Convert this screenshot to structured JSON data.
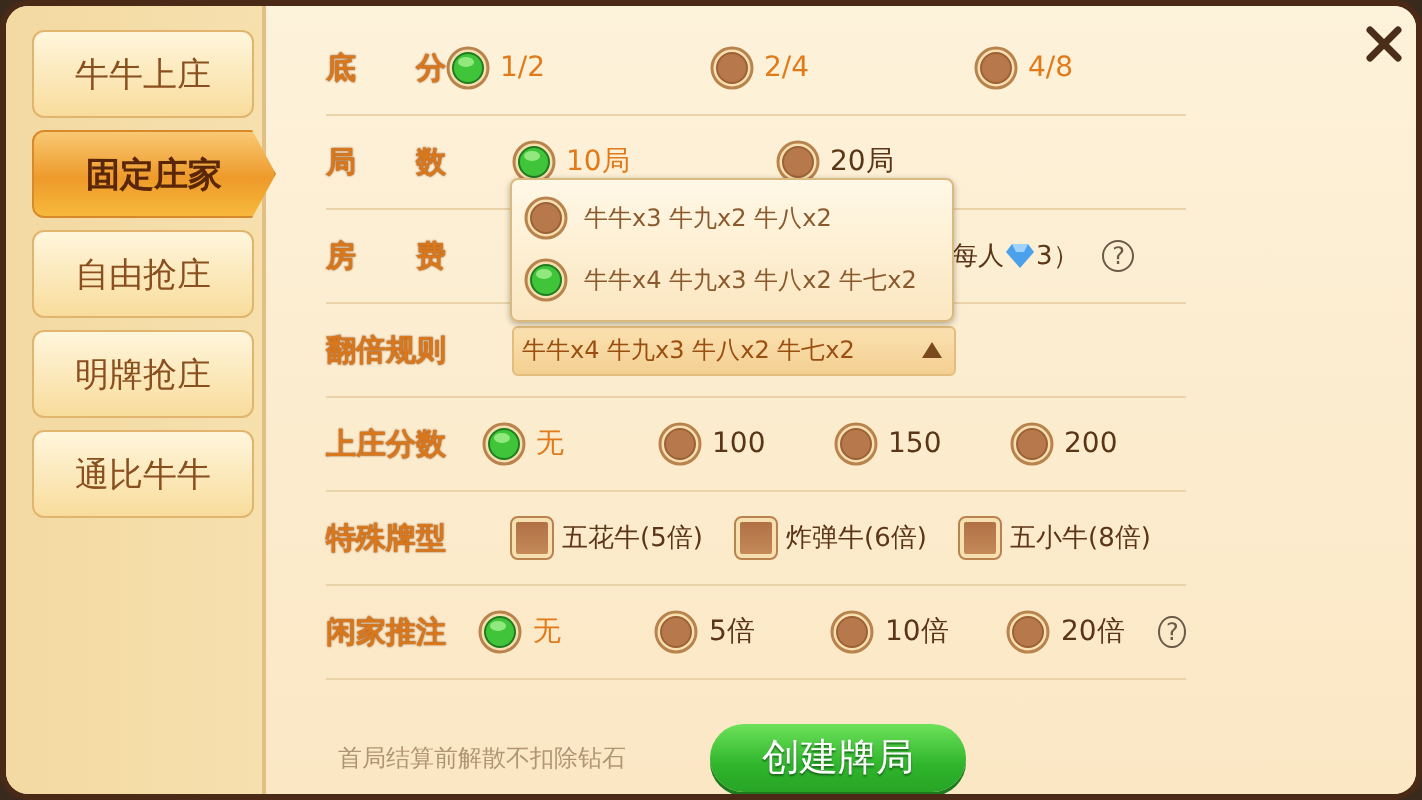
{
  "sidebar": {
    "tabs": [
      {
        "label": "牛牛上庄",
        "selected": false
      },
      {
        "label": "固定庄家",
        "selected": true
      },
      {
        "label": "自由抢庄",
        "selected": false
      },
      {
        "label": "明牌抢庄",
        "selected": false
      },
      {
        "label": "通比牛牛",
        "selected": false
      }
    ]
  },
  "rows": [
    {
      "kind": "radio",
      "label": "底　　分",
      "options": [
        {
          "label": "1/2",
          "selected": true
        },
        {
          "label": "2/4",
          "selected": false
        },
        {
          "label": "4/8",
          "selected": false
        }
      ]
    },
    {
      "kind": "radio",
      "label": "局　　数",
      "options": [
        {
          "label": "10局",
          "selected": true
        },
        {
          "label": "20局",
          "selected": false
        }
      ]
    },
    {
      "kind": "fee",
      "label": "房　　费",
      "text": "每人",
      "amount": "3）",
      "help": "?"
    },
    {
      "kind": "dropdown",
      "label": "翻倍规则",
      "value": "牛牛x4 牛九x3 牛八x2 牛七x2",
      "expanded": true,
      "options": [
        {
          "label": "牛牛x3 牛九x2 牛八x2",
          "selected": false
        },
        {
          "label": "牛牛x4 牛九x3 牛八x2 牛七x2",
          "selected": true
        }
      ]
    },
    {
      "kind": "radio",
      "label": "上庄分数",
      "options": [
        {
          "label": "无",
          "selected": true
        },
        {
          "label": "100",
          "selected": false
        },
        {
          "label": "150",
          "selected": false
        },
        {
          "label": "200",
          "selected": false
        }
      ]
    },
    {
      "kind": "check",
      "label": "特殊牌型",
      "options": [
        {
          "label": "五花牛(5倍)",
          "checked": false
        },
        {
          "label": "炸弹牛(6倍)",
          "checked": false
        },
        {
          "label": "五小牛(8倍)",
          "checked": false
        }
      ]
    },
    {
      "kind": "radio",
      "label": "闲家推注",
      "help": "?",
      "options": [
        {
          "label": "无",
          "selected": true
        },
        {
          "label": "5倍",
          "selected": false
        },
        {
          "label": "10倍",
          "selected": false
        },
        {
          "label": "20倍",
          "selected": false
        }
      ]
    }
  ],
  "footer": {
    "note": "首局结算前解散不扣除钻石",
    "button": "创建牌局"
  }
}
